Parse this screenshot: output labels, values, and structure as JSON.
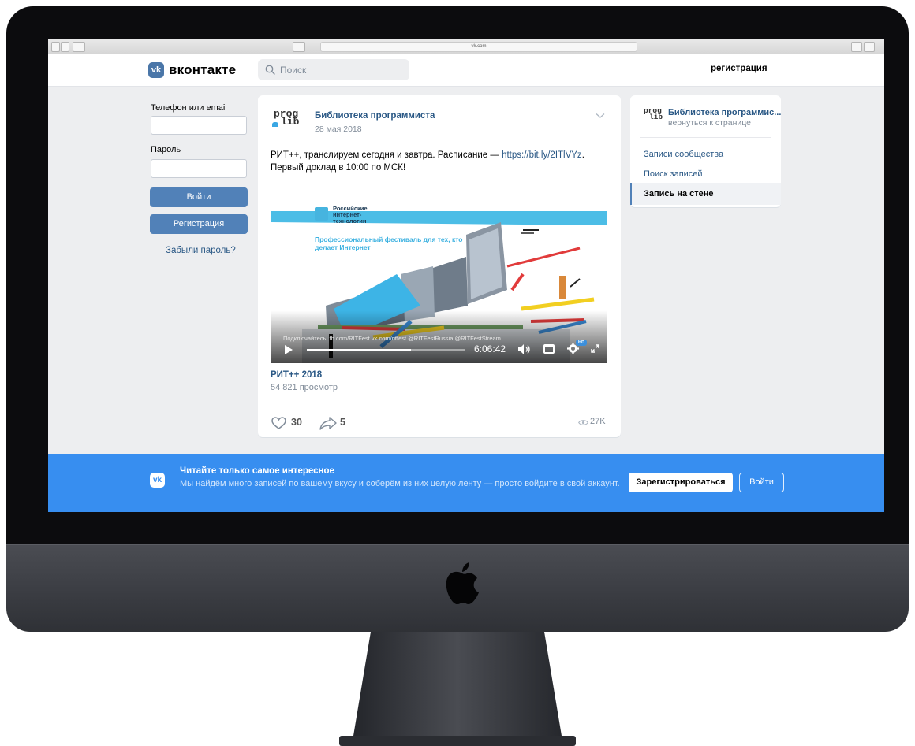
{
  "browser": {
    "url": "vk.com"
  },
  "header": {
    "brand": "вконтакте",
    "search_placeholder": "Поиск",
    "register_link": "регистрация"
  },
  "login": {
    "phone_label": "Телефон или email",
    "password_label": "Пароль",
    "login_button": "Войти",
    "register_button": "Регистрация",
    "forgot_link": "Забыли пароль?"
  },
  "post": {
    "logo_line1": "prog",
    "logo_line2": "lib",
    "author": "Библиотека программиста",
    "date": "28 мая 2018",
    "text_before_link": "РИТ++, транслируем сегодня и завтра. Расписание — ",
    "link": "https://bit.ly/2ITlVYz",
    "text_after_link": ". Первый доклад в 10:00 по МСК!",
    "video": {
      "brand_name": "Российские\nинтернет-\nтехнологии",
      "festival_text": "Профессиональный фестиваль для тех, кто делает Интернет",
      "connect_text": "Подключайтесь:  fb.com/RITFest   vk.com/ritfest   @RITFestRussia   @RITFestStream",
      "time": "6:06:42",
      "hd_badge": "HD",
      "progress": 0.66,
      "title": "РИТ++ 2018",
      "views": "54 821 просмотр"
    },
    "likes": "30",
    "shares": "5",
    "views": "27K"
  },
  "sidebar": {
    "group_name": "Библиотека программис...",
    "group_back": "вернуться к странице",
    "items": [
      {
        "label": "Записи сообщества"
      },
      {
        "label": "Поиск записей"
      },
      {
        "label": "Запись на стене"
      }
    ]
  },
  "banner": {
    "title": "Читайте только самое интересное",
    "text": "Мы найдём много записей по вашему вкусу и соберём из них целую ленту — просто войдите в свой аккаунт.",
    "register_button": "Зарегистрироваться",
    "login_button": "Войти"
  },
  "colors": {
    "vk_blue": "#5181b8",
    "banner_blue": "#378ef0",
    "link": "#2a5885"
  }
}
